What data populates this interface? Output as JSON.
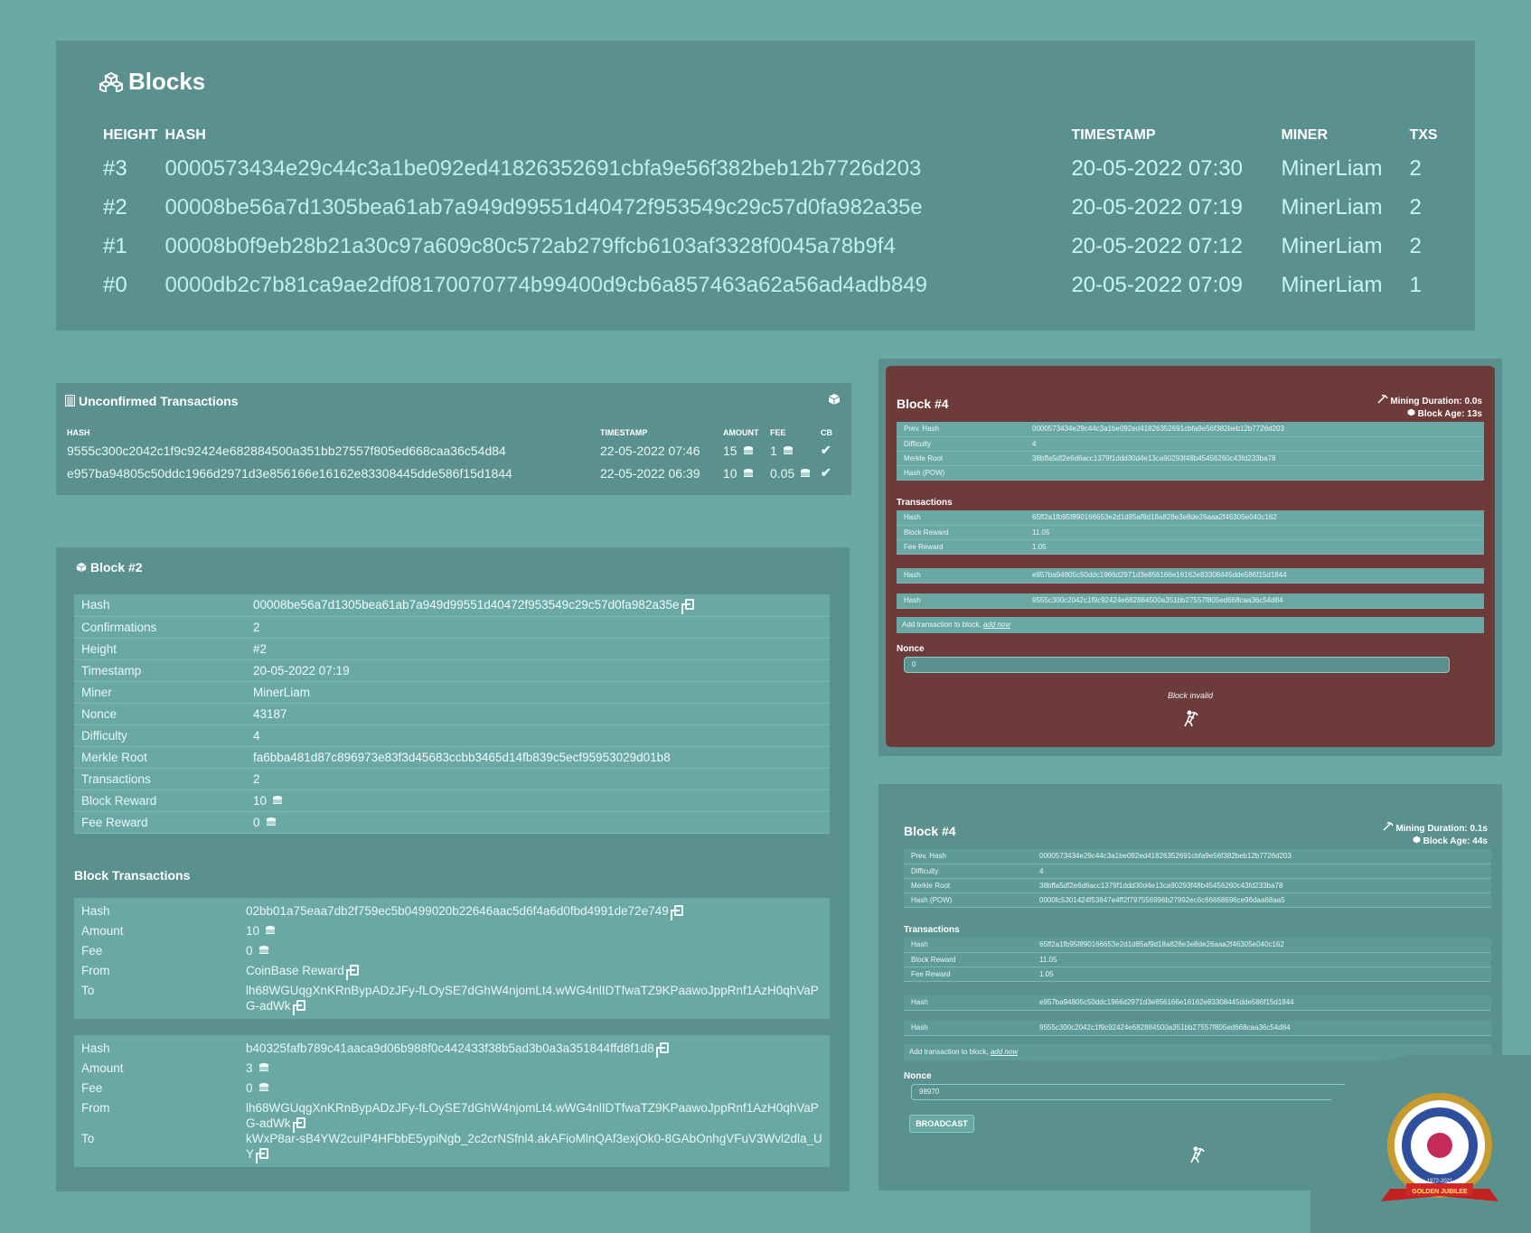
{
  "blocks": {
    "title": "Blocks",
    "headers": {
      "height": "HEIGHT",
      "hash": "HASH",
      "timestamp": "TIMESTAMP",
      "miner": "MINER",
      "txs": "TXS"
    },
    "rows": [
      {
        "height": "#3",
        "hash": "0000573434e29c44c3a1be092ed41826352691cbfa9e56f382beb12b7726d203",
        "timestamp": "20-05-2022 07:30",
        "miner": "MinerLiam",
        "txs": "2"
      },
      {
        "height": "#2",
        "hash": "00008be56a7d1305bea61ab7a949d99551d40472f953549c29c57d0fa982a35e",
        "timestamp": "20-05-2022 07:19",
        "miner": "MinerLiam",
        "txs": "2"
      },
      {
        "height": "#1",
        "hash": "00008b0f9eb28b21a30c97a609c80c572ab279ffcb6103af3328f0045a78b9f4",
        "timestamp": "20-05-2022 07:12",
        "miner": "MinerLiam",
        "txs": "2"
      },
      {
        "height": "#0",
        "hash": "0000db2c7b81ca9ae2df08170070774b99400d9cb6a857463a62a56ad4adb849",
        "timestamp": "20-05-2022 07:09",
        "miner": "MinerLiam",
        "txs": "1"
      }
    ]
  },
  "unconfirmed": {
    "title": "Unconfirmed Transactions",
    "headers": {
      "hash": "HASH",
      "timestamp": "TIMESTAMP",
      "amount": "AMOUNT",
      "fee": "FEE",
      "cb": "CB"
    },
    "rows": [
      {
        "hash": "9555c300c2042c1f9c92424e682884500a351bb27557f805ed668caa36c54d84",
        "timestamp": "22-05-2022 07:46",
        "amount": "15",
        "fee": "1",
        "cb": "✔"
      },
      {
        "hash": "e957ba94805c50ddc1966d2971d3e856166e16162e83308445dde586f15d1844",
        "timestamp": "22-05-2022 06:39",
        "amount": "10",
        "fee": "0.05",
        "cb": "✔"
      }
    ]
  },
  "block2": {
    "title": "Block #2",
    "rows": [
      {
        "k": "Hash",
        "v": "00008be56a7d1305bea61ab7a949d99551d40472f953549c29c57d0fa982a35e"
      },
      {
        "k": "Confirmations",
        "v": "2"
      },
      {
        "k": "Height",
        "v": "#2"
      },
      {
        "k": "Timestamp",
        "v": "20-05-2022 07:19"
      },
      {
        "k": "Miner",
        "v": "MinerLiam"
      },
      {
        "k": "Nonce",
        "v": "43187"
      },
      {
        "k": "Difficulty",
        "v": "4"
      },
      {
        "k": "Merkle Root",
        "v": "fa6bba481d87c896973e83f3d45683ccbb3465d14fb839c5ecf95953029d01b8"
      },
      {
        "k": "Transactions",
        "v": "2"
      },
      {
        "k": "Block Reward",
        "v": "10"
      },
      {
        "k": "Fee Reward",
        "v": "0"
      }
    ],
    "transactions_title": "Block Transactions",
    "tx1": {
      "hash_k": "Hash",
      "hash": "02bb01a75eaa7db2f759ec5b0499020b22646aac5d6f4a6d0fbd4991de72e749",
      "amount_k": "Amount",
      "amount": "10",
      "fee_k": "Fee",
      "fee": "0",
      "from_k": "From",
      "from": "CoinBase Reward",
      "to_k": "To",
      "to": "lh68WGUqgXnKRnBypADzJFy-fLOySE7dGhW4njomLt4.wWG4nlIDTfwaTZ9KPaawoJppRnf1AzH0qhVaPG-adWk"
    },
    "tx2": {
      "hash_k": "Hash",
      "hash": "b40325fafb789c41aaca9d06b988f0c442433f38b5ad3b0a3a351844ffd8f1d8",
      "amount_k": "Amount",
      "amount": "3",
      "fee_k": "Fee",
      "fee": "0",
      "from_k": "From",
      "from": "lh68WGUqgXnKRnBypADzJFy-fLOySE7dGhW4njomLt4.wWG4nlIDTfwaTZ9KPaawoJppRnf1AzH0qhVaPG-adWk",
      "to_k": "To",
      "to": "kWxP8ar-sB4YW2cuIP4HFbbE5ypiNgb_2c2crNSfnl4.akAFioMlnQAf3exjOk0-8GAbOnhgVFuV3Wvl2dla_UY"
    }
  },
  "block4_invalid": {
    "title": "Block #4",
    "mining_duration": "Mining Duration: 0.0s",
    "block_age": "Block Age: 13s",
    "prev_hash_k": "Prev. Hash",
    "prev_hash": "0000573434e29c44c3a1be092ed41826352691cbfa9e56f382beb12b7726d203",
    "difficulty_k": "Difficulty",
    "difficulty": "4",
    "merkle_k": "Merkle Root",
    "merkle": "38bffa5df2e6d6acc1379f1ddd30d4e13ca90293f48b45456260c43fd233ba78",
    "hashpow_k": "Hash (POW)",
    "hashpow": "",
    "transactions_title": "Transactions",
    "tx_hash_k": "Hash",
    "tx_hash": "65ff2a1fb95f890166653e2d1d85af9d18a828e3e8de26aaa2f46305e040c162",
    "block_reward_k": "Block Reward",
    "block_reward": "11.05",
    "fee_reward_k": "Fee Reward",
    "fee_reward": "1.05",
    "tx2_k": "Hash",
    "tx2": "e957ba94805c50ddc1966d2971d3e856166e16162e83308445dde586f15d1844",
    "tx3_k": "Hash",
    "tx3": "9555c300c2042c1f9c92424e682884500a351bb27557f805ed668caa36c54d84",
    "add_tx": "Add transaction to block,",
    "add_now": "add now",
    "nonce_label": "Nonce",
    "nonce_value": "0",
    "status": "Block invalid"
  },
  "block4_valid": {
    "title": "Block #4",
    "mining_duration": "Mining Duration: 0.1s",
    "block_age": "Block Age: 44s",
    "prev_hash_k": "Prev. Hash",
    "prev_hash": "0000573434e29c44c3a1be092ed41826352691cbfa9e56f382beb12b7726d203",
    "difficulty_k": "Difficulty",
    "difficulty": "4",
    "merkle_k": "Merkle Root",
    "merkle": "38bffa5df2e6d6acc1379f1ddd30d4e13ca90293f48b45456260c43fd233ba78",
    "hashpow_k": "Hash (POW)",
    "hashpow": "0000fc5301424f53847e4ff2f797556996b27992ec6c66668696ce96daa68aa5",
    "transactions_title": "Transactions",
    "tx_hash_k": "Hash",
    "tx_hash": "65ff2a1fb95f890166653e2d1d85af9d18a828e3e8de26aaa2f46305e040c162",
    "block_reward_k": "Block Reward",
    "block_reward": "11.05",
    "fee_reward_k": "Fee Reward",
    "fee_reward": "1.05",
    "tx2_k": "Hash",
    "tx2": "e957ba94805c50ddc1966d2971d3e856166e16162e83308445dde586f15d1844",
    "tx3_k": "Hash",
    "tx3": "9555c300c2042c1f9c92424e682884500a351bb27557f805ed668caa36c54d84",
    "add_tx": "Add transaction to block,",
    "add_now": "add now",
    "nonce_label": "Nonce",
    "nonce_value": "98970",
    "broadcast": "BROADCAST"
  },
  "badge": {
    "text": "GOLDEN JUBILEE",
    "years": "1972-2021"
  },
  "colors": {
    "background": "#6aa8a5",
    "panel": "#5a918e",
    "invalid_card": "#6e3b3b",
    "check": "#8ff07f"
  }
}
